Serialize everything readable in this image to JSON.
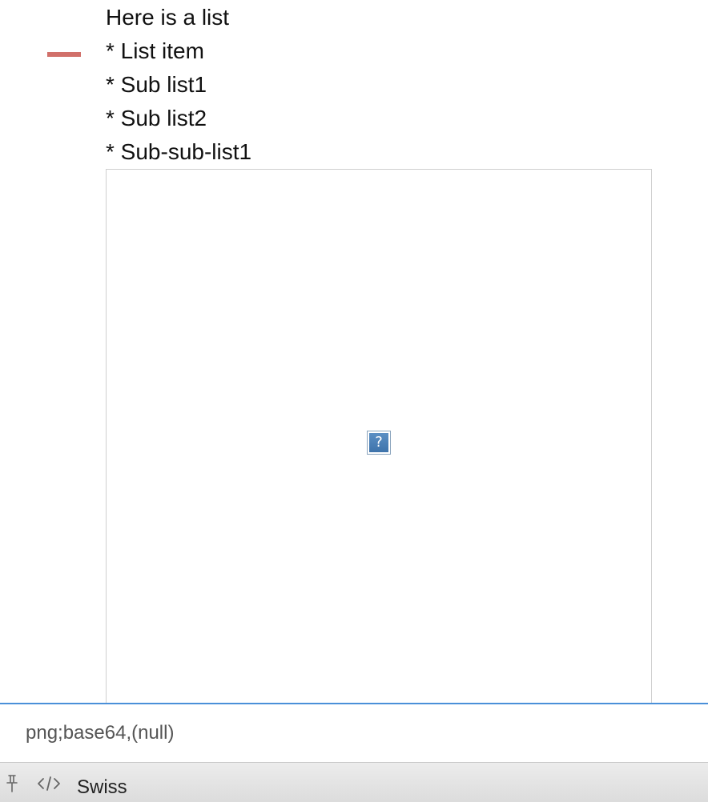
{
  "document": {
    "lines": [
      "Here is a list",
      "* List item",
      "* Sub list1",
      "* Sub list2",
      "* Sub-sub-list1"
    ],
    "broken_image_glyph": "?"
  },
  "source_panel": {
    "text": "png;base64,(null)"
  },
  "status_bar": {
    "language": "Swiss",
    "icons": [
      "pin-icon",
      "code-icon"
    ]
  },
  "colors": {
    "change_marker": "#d1706a",
    "divider": "#4a90d9"
  }
}
